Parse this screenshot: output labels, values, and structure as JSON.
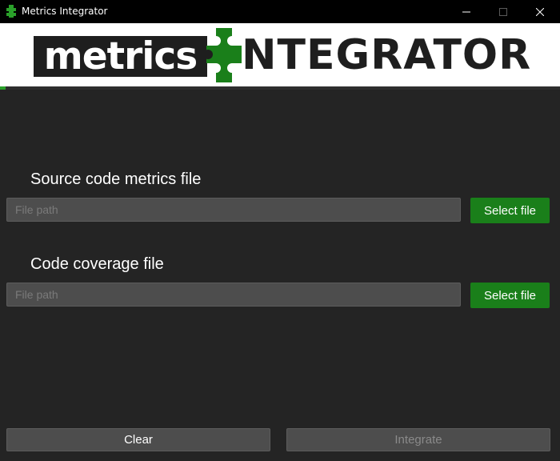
{
  "window": {
    "title": "Metrics Integrator",
    "minimize_icon": "minimize-icon",
    "maximize_icon": "maximize-icon",
    "close_icon": "close-icon"
  },
  "banner": {
    "logo_left": "metrics",
    "logo_right": "NTEGRATOR",
    "brand_green": "#1a7f1a",
    "progress": 0.01
  },
  "sections": [
    {
      "label": "Source code metrics file",
      "input_value": "",
      "input_placeholder": "File path",
      "button_label": "Select file"
    },
    {
      "label": "Code coverage file",
      "input_value": "",
      "input_placeholder": "File path",
      "button_label": "Select file"
    }
  ],
  "actions": {
    "clear_label": "Clear",
    "integrate_label": "Integrate",
    "integrate_enabled": false
  }
}
